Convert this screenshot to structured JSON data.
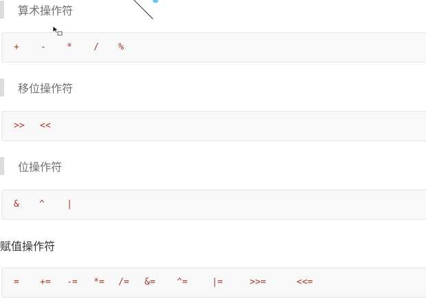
{
  "sections": [
    {
      "heading": "算术操作符",
      "operators": [
        "+",
        "-",
        "*",
        "/",
        "%"
      ]
    },
    {
      "heading": "移位操作符",
      "operators": [
        ">>",
        "<<"
      ]
    },
    {
      "heading": "位操作符",
      "operators": [
        "&",
        "^",
        "|"
      ]
    },
    {
      "heading": "赋值操作符",
      "operators": [
        "=",
        "+=",
        "-=",
        "*=",
        "/=",
        "&=",
        "^=",
        "|=",
        ">>=",
        "<<="
      ]
    }
  ],
  "colors": {
    "operator": "#a33a2a",
    "code_bg": "#f8f8f8",
    "quote_bar": "#dcdcdc"
  }
}
